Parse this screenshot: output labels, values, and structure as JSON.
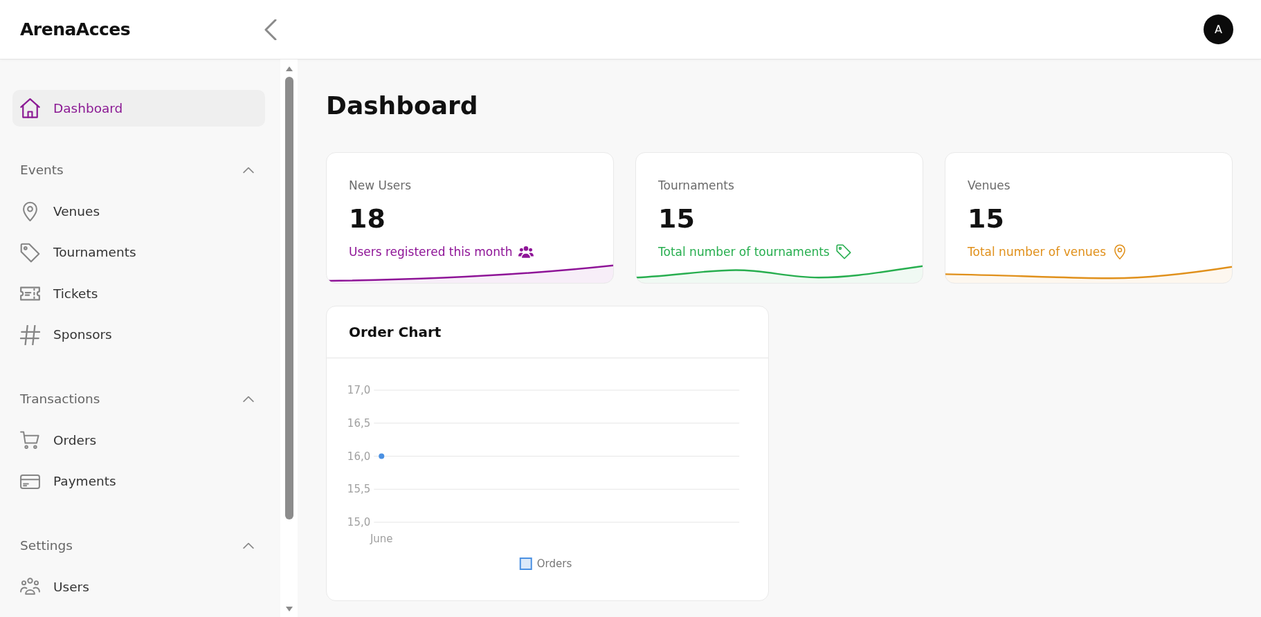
{
  "header": {
    "logo": "ArenaAcces",
    "avatar": "A"
  },
  "sidebar": {
    "items": [
      {
        "label": "Dashboard",
        "selected": true
      }
    ],
    "sections": [
      {
        "title": "Events",
        "expanded": true,
        "items": [
          {
            "label": "Venues",
            "selected": false
          },
          {
            "label": "Tournaments",
            "selected": false
          },
          {
            "label": "Tickets",
            "selected": false
          },
          {
            "label": "Sponsors",
            "selected": false
          }
        ]
      },
      {
        "title": "Transactions",
        "expanded": true,
        "items": [
          {
            "label": "Orders",
            "selected": false
          },
          {
            "label": "Payments",
            "selected": false
          }
        ]
      },
      {
        "title": "Settings",
        "expanded": true,
        "items": [
          {
            "label": "Users",
            "selected": false
          }
        ]
      }
    ]
  },
  "page": {
    "title": "Dashboard"
  },
  "stat_cards": [
    {
      "label": "New Users",
      "value": "18",
      "caption": "Users registered this month",
      "color": "#8e1497"
    },
    {
      "label": "Tournaments",
      "value": "15",
      "caption": "Total number of tournaments",
      "color": "#27ae4f"
    },
    {
      "label": "Venues",
      "value": "15",
      "caption": "Total number of venues",
      "color": "#e0901b"
    }
  ],
  "order_chart": {
    "title": "Order Chart",
    "chart_data": {
      "type": "line",
      "grid": true,
      "categories": [
        "June"
      ],
      "series": [
        {
          "name": "Orders",
          "color": "#4a90e2",
          "marker": true,
          "values": [
            16
          ]
        }
      ],
      "ylim": [
        15,
        17
      ],
      "yticks": [
        {
          "value": 15,
          "label": "15,0"
        },
        {
          "value": 15.5,
          "label": "15,5"
        },
        {
          "value": 16,
          "label": "16,0"
        },
        {
          "value": 16.5,
          "label": "16,5"
        },
        {
          "value": 17,
          "label": "17,0"
        }
      ]
    }
  }
}
